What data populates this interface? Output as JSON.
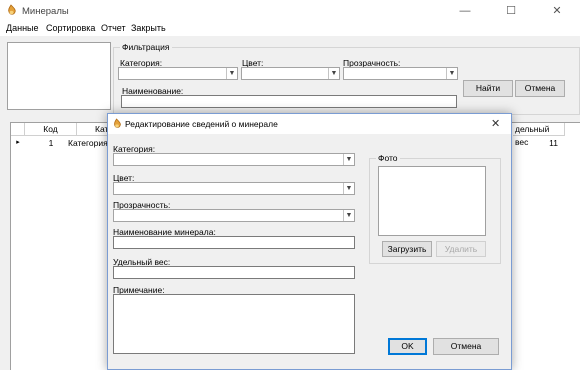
{
  "main_window": {
    "title": "Минералы",
    "controls": {
      "minimize": "—",
      "maximize": "☐",
      "close": "✕"
    },
    "menu": [
      "Данные",
      "Сортировка",
      "Отчет",
      "Закрыть"
    ]
  },
  "filter": {
    "group_title": "Фильтрация",
    "category_label": "Категория:",
    "color_label": "Цвет:",
    "transparency_label": "Прозрачность:",
    "name_label": "Наименование:",
    "find_button": "Найти",
    "cancel_button": "Отмена"
  },
  "grid": {
    "columns": [
      "Код",
      "Кат",
      "дельный вес"
    ],
    "rows": [
      {
        "marker": "▸",
        "code": "1",
        "category": "Категория",
        "weight": "11"
      }
    ]
  },
  "dialog": {
    "title": "Редактирование сведений о минерале",
    "close": "✕",
    "category_label": "Категория:",
    "color_label": "Цвет:",
    "transparency_label": "Прозрачность:",
    "mineral_name_label": "Наименование минерала:",
    "specific_weight_label": "Удельный вес:",
    "note_label": "Примечание:",
    "photo_group_title": "Фото",
    "load_button": "Загрузить",
    "delete_button": "Удалить",
    "ok_button": "OK",
    "cancel_button": "Отмена"
  }
}
